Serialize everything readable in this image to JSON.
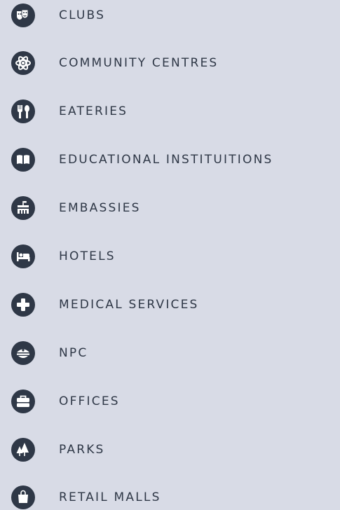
{
  "menu": {
    "items": [
      {
        "label": "CLUBS",
        "icon": "theater-masks-icon"
      },
      {
        "label": "COMMUNITY CENTRES",
        "icon": "atom-icon"
      },
      {
        "label": "EATERIES",
        "icon": "utensils-icon"
      },
      {
        "label": "EDUCATIONAL INSTITUITIONS",
        "icon": "open-book-icon"
      },
      {
        "label": "EMBASSIES",
        "icon": "embassy-building-icon"
      },
      {
        "label": "HOTELS",
        "icon": "bed-icon"
      },
      {
        "label": "MEDICAL SERVICES",
        "icon": "medical-cross-icon"
      },
      {
        "label": "NPC",
        "icon": "police-cap-icon"
      },
      {
        "label": "OFFICES",
        "icon": "briefcase-icon"
      },
      {
        "label": "PARKS",
        "icon": "trees-icon"
      },
      {
        "label": "RETAIL MALLS",
        "icon": "shopping-bag-icon"
      }
    ]
  },
  "colors": {
    "background": "#d8dbe6",
    "icon_circle": "#2f3847",
    "icon_glyph": "#ffffff",
    "label_text": "#2f3847"
  }
}
